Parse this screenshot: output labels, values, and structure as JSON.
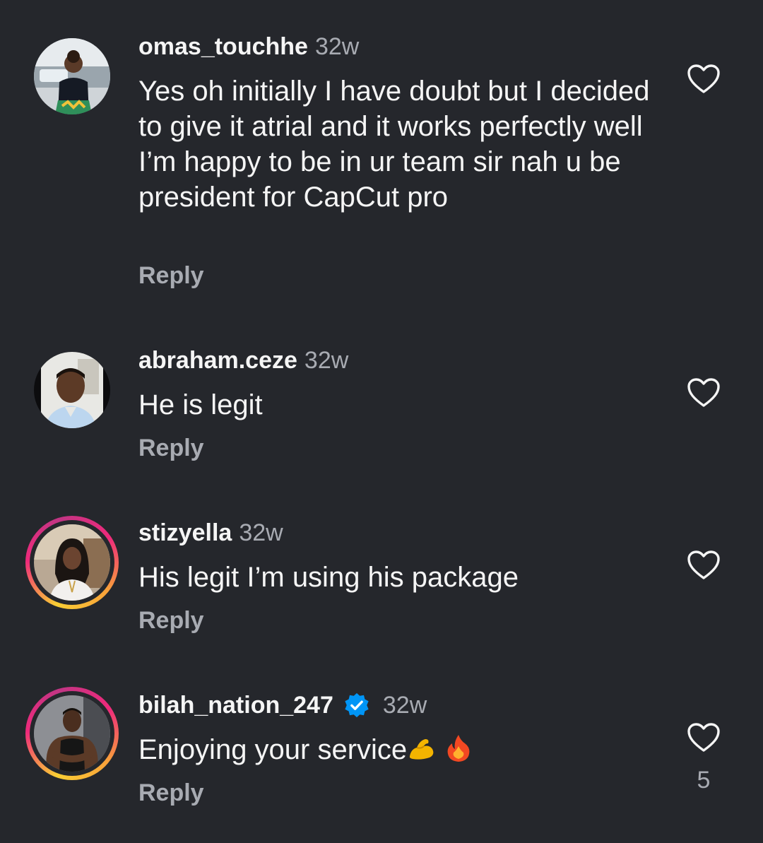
{
  "comments": [
    {
      "username": "omas_touchhe",
      "time": "32w",
      "text": "Yes oh initially I have doubt but I decided to give it atrial and it works perfectly well I’m happy to be in ur team sir nah u be president for CapCut pro",
      "reply_label": "Reply",
      "has_story_ring": false,
      "verified": false
    },
    {
      "username": "abraham.ceze",
      "time": "32w",
      "text": "He is legit",
      "reply_label": "Reply",
      "has_story_ring": false,
      "verified": false
    },
    {
      "username": "stizyella",
      "time": "32w",
      "text": "His legit I’m using his package",
      "reply_label": "Reply",
      "has_story_ring": true,
      "verified": false
    },
    {
      "username": "bilah_nation_247",
      "time": "32w",
      "text": "Enjoying your service",
      "emojis": [
        "flexed-biceps-emoji",
        "fire-emoji"
      ],
      "reply_label": "Reply",
      "has_story_ring": true,
      "verified": true,
      "like_count": "5"
    }
  ],
  "icons": {
    "like": "heart-outline-icon",
    "verified": "verified-badge-icon"
  },
  "colors": {
    "background": "#25272c",
    "primary_text": "#f5f5f5",
    "secondary_text": "#a8abb2",
    "verified_blue": "#0095f6"
  }
}
